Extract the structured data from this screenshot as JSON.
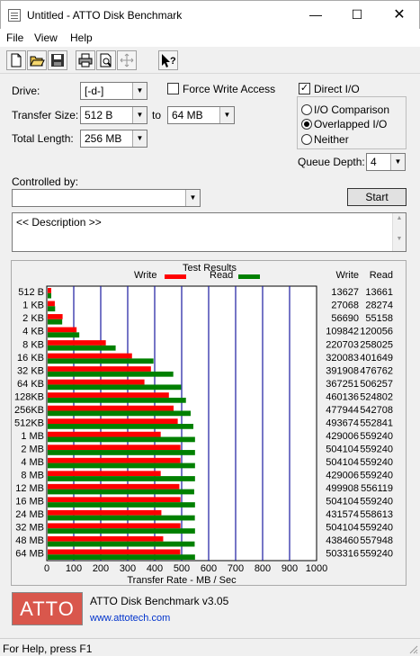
{
  "window": {
    "title": "Untitled - ATTO Disk Benchmark"
  },
  "menu": [
    "File",
    "View",
    "Help"
  ],
  "toolbar": {
    "buttons": [
      "new-icon",
      "open-icon",
      "save-icon",
      "print-icon",
      "print-preview-icon",
      "move-icon",
      "help-icon"
    ]
  },
  "settings": {
    "drive_label": "Drive:",
    "drive_value": "[-d-]",
    "transfer_size_label": "Transfer Size:",
    "transfer_from": "512 B",
    "to_label": "to",
    "transfer_to": "64 MB",
    "total_length_label": "Total Length:",
    "total_length_value": "256 MB",
    "force_write_label": "Force Write Access",
    "direct_io_label": "Direct I/O",
    "io_comparison_label": "I/O Comparison",
    "overlapped_io_label": "Overlapped I/O",
    "neither_label": "Neither",
    "queue_depth_label": "Queue Depth:",
    "queue_depth_value": "4",
    "controlled_by_label": "Controlled by:",
    "controlled_by_value": "",
    "start_label": "Start",
    "description_text": "<< Description >>"
  },
  "results": {
    "title": "Test Results",
    "write_legend": "Write",
    "read_legend": "Read",
    "write_col": "Write",
    "read_col": "Read",
    "write_color": "#ff0000",
    "read_color": "#008000"
  },
  "chart_data": {
    "type": "bar",
    "orientation": "horizontal",
    "categories": [
      "512 B",
      "1 KB",
      "2 KB",
      "4 KB",
      "8 KB",
      "16 KB",
      "32 KB",
      "64 KB",
      "128KB",
      "256KB",
      "512KB",
      "1 MB",
      "2 MB",
      "4 MB",
      "8 MB",
      "12 MB",
      "16 MB",
      "24 MB",
      "32 MB",
      "48 MB",
      "64 MB"
    ],
    "series": [
      {
        "name": "Write",
        "values": [
          13627,
          27068,
          56690,
          109842,
          220703,
          320083,
          391908,
          367251,
          460136,
          477944,
          493674,
          429006,
          504104,
          504104,
          429006,
          499908,
          504104,
          431574,
          504104,
          438460,
          503316
        ]
      },
      {
        "name": "Read",
        "values": [
          13661,
          28274,
          55158,
          120056,
          258025,
          401649,
          476762,
          506257,
          524802,
          542708,
          552841,
          559240,
          559240,
          559240,
          559240,
          556119,
          559240,
          558613,
          559240,
          557948,
          559240
        ]
      }
    ],
    "xlabel": "Transfer Rate - MB / Sec",
    "xlim": [
      0,
      1000
    ],
    "xticks": [
      "0",
      "100",
      "200",
      "300",
      "400",
      "500",
      "600",
      "700",
      "800",
      "900",
      "1000"
    ],
    "value_units": "KB/s"
  },
  "footer": {
    "logo_text": "ATTO",
    "product": "ATTO Disk Benchmark v3.05",
    "url": "www.attotech.com"
  },
  "status": {
    "text": "For Help, press F1"
  }
}
